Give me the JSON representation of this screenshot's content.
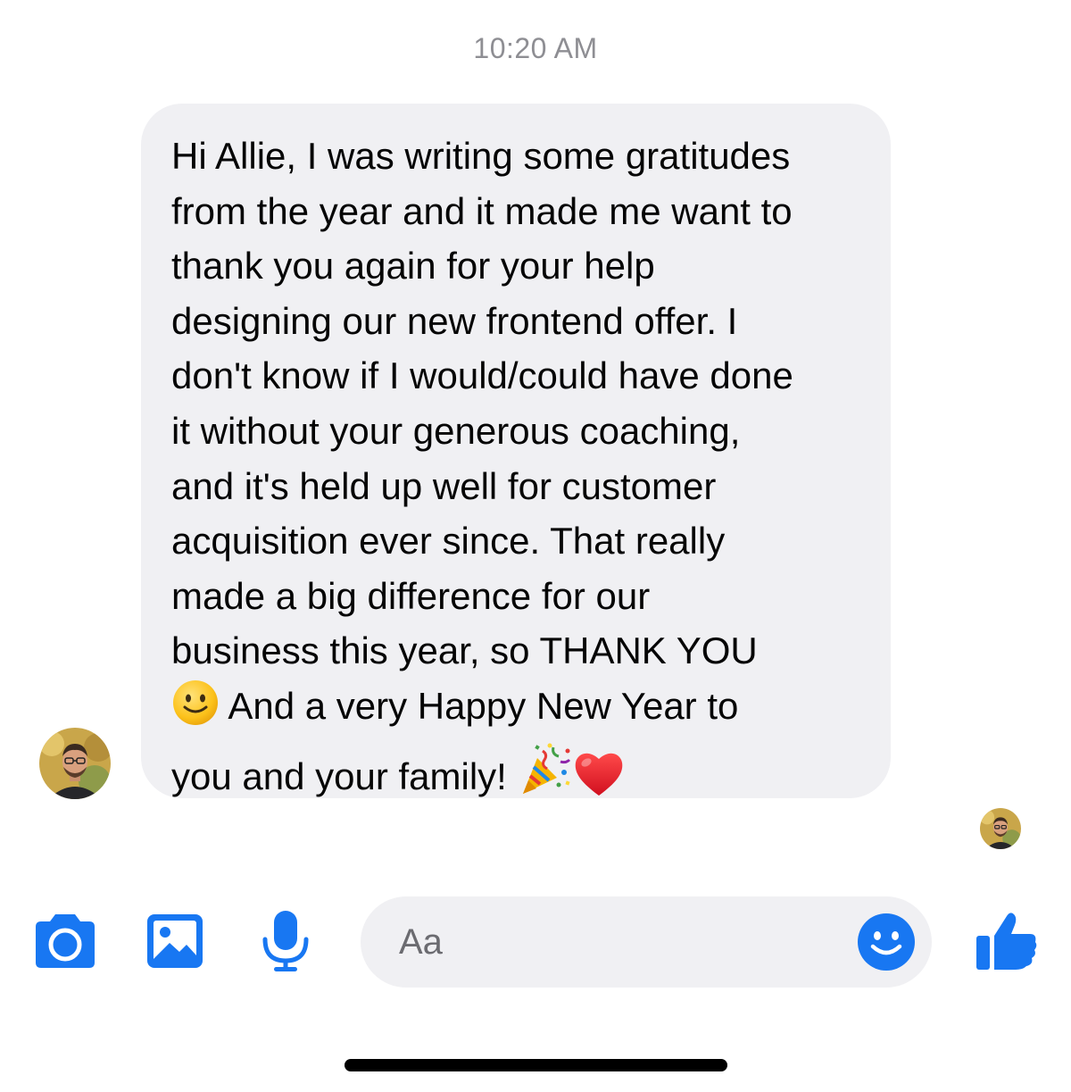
{
  "conversation": {
    "timestamp": "10:20 AM",
    "message": {
      "text_before_smile": "Hi Allie, I was writing some gratitudes\nfrom the year and it made me want to\nthank you again for your help\ndesigning our new frontend offer. I\ndon't know if I would/could have done\nit without your generous coaching,\nand it's held up well for customer\nacquisition ever since. That really\nmade a big difference for our\nbusiness this year, so THANK YOU\n",
      "text_after_smile": "  And a very Happy New Year to\nyou and your family! ",
      "emojis": [
        "slightly-smiling-face",
        "party-popper",
        "red-heart"
      ]
    }
  },
  "composer": {
    "placeholder": "Aa",
    "icons": [
      "camera-icon",
      "gallery-icon",
      "microphone-icon",
      "emoji-icon",
      "thumbs-up-icon"
    ],
    "accent_color": "#1877f2"
  },
  "colors": {
    "bubble_background": "#f0f0f3",
    "text": "#050505",
    "timestamp": "#8e8e93"
  }
}
